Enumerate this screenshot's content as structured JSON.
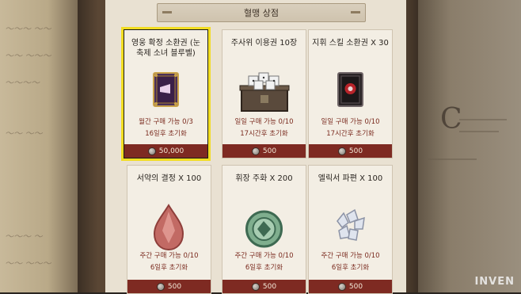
{
  "shop": {
    "title": "혈맹 상점"
  },
  "cards": [
    {
      "name": "영웅 확정 소환권 (눈 축제 소녀 블루벨)",
      "limit": "월간 구매 가능 0/3",
      "reset": "16일후 초기화",
      "price": "50,000",
      "selected": true,
      "icon": "hero-summon-card-icon"
    },
    {
      "name": "주사위 이용권 10장",
      "limit": "일일 구매 가능 0/10",
      "reset": "17시간후 초기화",
      "price": "500",
      "icon": "dice-chest-icon"
    },
    {
      "name": "지휘 스킬 소환권 X 30",
      "limit": "일일 구매 가능 0/10",
      "reset": "17시간후 초기화",
      "price": "500",
      "icon": "skill-summon-card-icon"
    },
    {
      "name": "서약의 결정 X 100",
      "limit": "주간 구매 가능 0/10",
      "reset": "6일후 초기화",
      "price": "500",
      "icon": "oath-crystal-icon"
    },
    {
      "name": "휘장 주화 X 200",
      "limit": "주간 구매 가능 0/10",
      "reset": "6일후 초기화",
      "price": "500",
      "icon": "emblem-coin-icon"
    },
    {
      "name": "엘릭서 파편 X 100",
      "limit": "주간 구매 가능 0/10",
      "reset": "6일후 초기화",
      "price": "500",
      "icon": "elixir-shard-icon"
    }
  ],
  "watermark": "INVEN",
  "colors": {
    "highlight": "#f2dd22",
    "price_bar": "#7e2a22",
    "limit_text": "#7a2a1e"
  }
}
